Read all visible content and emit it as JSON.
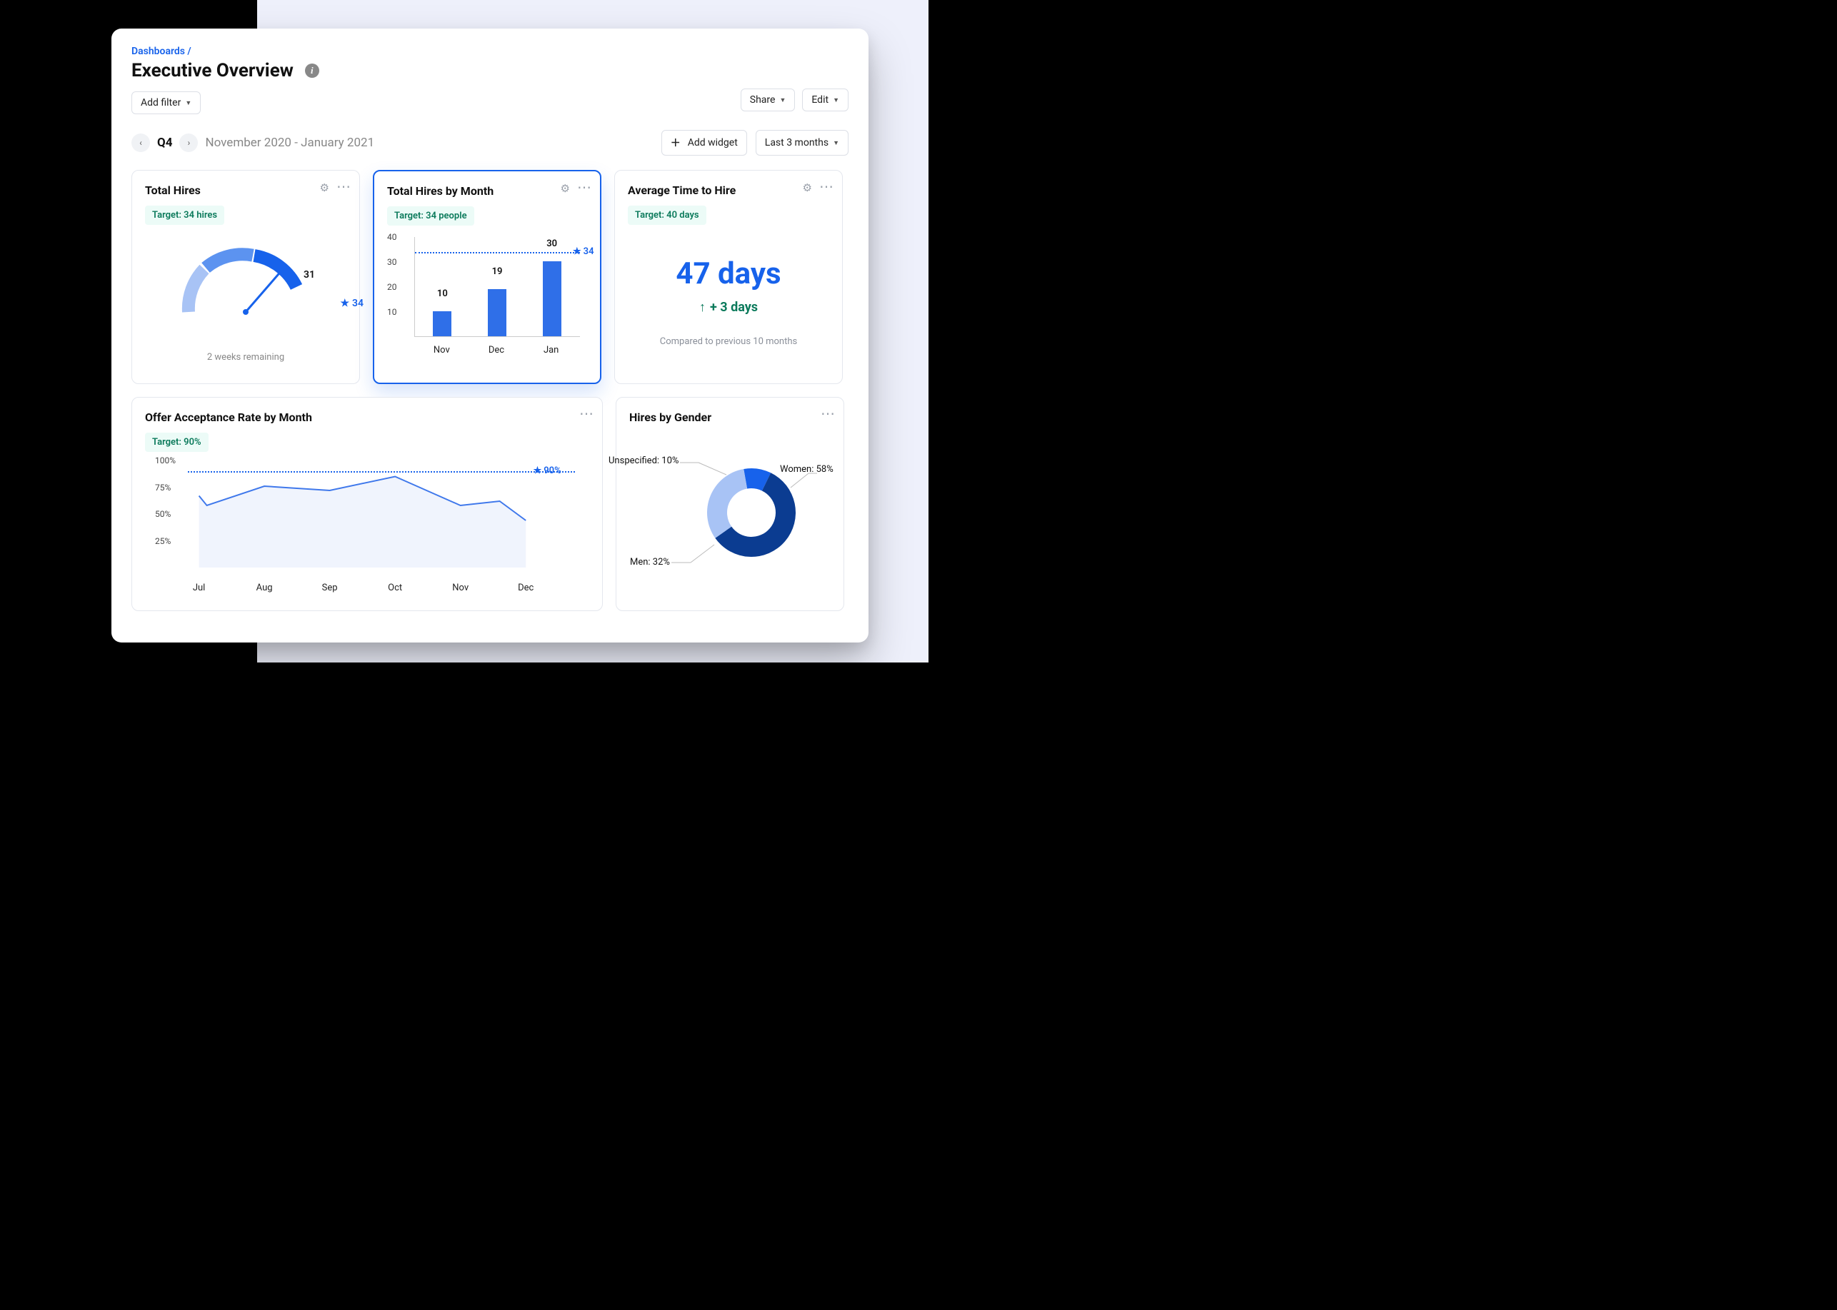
{
  "breadcrumb": "Dashboards /",
  "title": "Executive Overview",
  "buttons": {
    "share": "Share",
    "edit": "Edit",
    "add_filter": "Add filter",
    "add_widget": "Add widget",
    "period_select": "Last 3 months"
  },
  "range": {
    "label": "Q4",
    "text": "November 2020 - January 2021"
  },
  "cards": {
    "total_hires": {
      "title": "Total Hires",
      "target": "Target: 34 hires",
      "value_label": "31",
      "goal_label": "34",
      "caption": "2 weeks remaining"
    },
    "hires_by_month": {
      "title": "Total Hires by Month",
      "target": "Target: 34 people",
      "goal_label": "34"
    },
    "avg_time": {
      "title": "Average Time to Hire",
      "target": "Target: 40 days",
      "value": "47 days",
      "delta": "+ 3 days",
      "note": "Compared to previous 10 months"
    },
    "offer_rate": {
      "title": "Offer Acceptance Rate by Month",
      "target": "Target: 90%",
      "goal_label": "90%"
    },
    "hires_gender": {
      "title": "Hires by Gender",
      "labels": {
        "unspecified": "Unspecified: 10%",
        "women": "Women: 58%",
        "men": "Men: 32%"
      }
    }
  },
  "chart_data": [
    {
      "id": "total_hires_gauge",
      "type": "gauge",
      "title": "Total Hires",
      "value": 31,
      "target": 34,
      "max": 40,
      "caption": "2 weeks remaining"
    },
    {
      "id": "hires_by_month_bar",
      "type": "bar",
      "title": "Total Hires by Month",
      "categories": [
        "Nov",
        "Dec",
        "Jan"
      ],
      "values": [
        10,
        19,
        30
      ],
      "target": 34,
      "ylabel": "",
      "ylim": [
        0,
        40
      ],
      "yticks": [
        10,
        20,
        30,
        40
      ]
    },
    {
      "id": "avg_time_kpi",
      "type": "kpi",
      "title": "Average Time to Hire",
      "value": 47,
      "unit": "days",
      "delta": 3,
      "target": 40,
      "note": "Compared to previous 10 months"
    },
    {
      "id": "offer_rate_line",
      "type": "line",
      "title": "Offer Acceptance Rate by Month",
      "categories": [
        "Jul",
        "Aug",
        "Sep",
        "Oct",
        "Nov",
        "Dec"
      ],
      "values": [
        58,
        76,
        72,
        85,
        58,
        44
      ],
      "second_point_jul": 67,
      "target": 90,
      "ylabel": "%",
      "ylim": [
        0,
        100
      ],
      "yticks": [
        25,
        50,
        75,
        100
      ]
    },
    {
      "id": "hires_gender_pie",
      "type": "pie",
      "title": "Hires by Gender",
      "series": [
        {
          "name": "Women",
          "value": 58,
          "color": "#0B3C91"
        },
        {
          "name": "Men",
          "value": 32,
          "color": "#A8C3F5"
        },
        {
          "name": "Unspecified",
          "value": 10,
          "color": "#1762EB"
        }
      ],
      "donut": true
    }
  ]
}
